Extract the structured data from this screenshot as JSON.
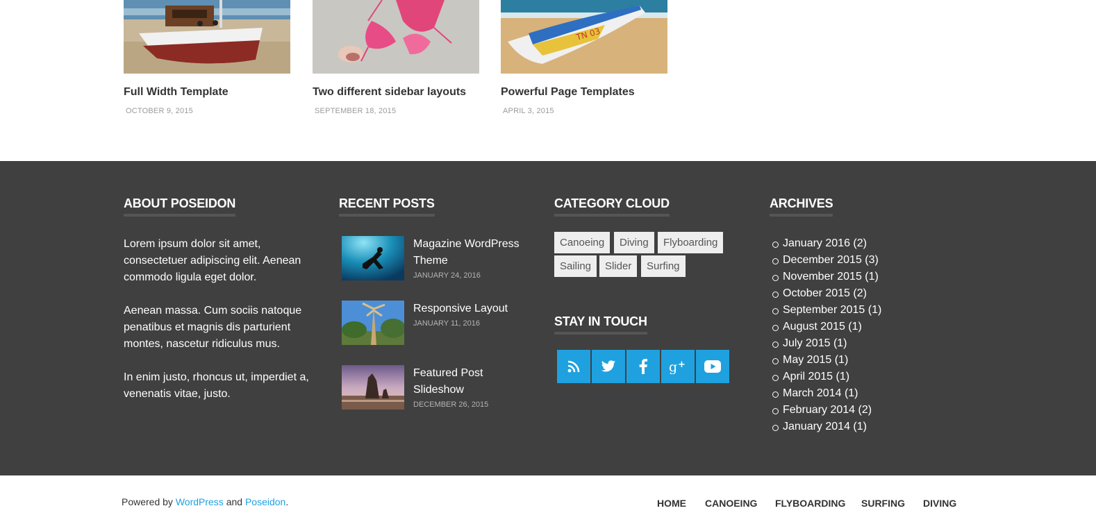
{
  "related_posts": [
    {
      "title": "Full Width Template",
      "date": "October 9, 2015",
      "image": "boat-on-beach-photo"
    },
    {
      "title": "Two different sidebar layouts",
      "date": "September 18, 2015",
      "image": "bikini-on-sand-photo"
    },
    {
      "title": "Powerful Page Templates",
      "date": "April 3, 2015",
      "image": "colorful-fishing-boat-photo"
    }
  ],
  "about": {
    "title": "About Poseidon",
    "paragraphs": [
      "Lorem ipsum dolor sit amet, consectetuer adipiscing elit. Aenean commodo ligula eget dolor.",
      "Aenean massa. Cum sociis natoque penatibus et magnis dis parturient montes, nascetur ridiculus mus.",
      "In enim justo, rhoncus ut, imperdiet a, venenatis vitae, justo."
    ]
  },
  "recent_posts": {
    "title": "Recent Posts",
    "items": [
      {
        "title": "Magazine WordPress Theme",
        "date": "January 24, 2016",
        "image": "diver-underwater-photo"
      },
      {
        "title": "Responsive Layout",
        "date": "January 11, 2016",
        "image": "palm-trees-sky-photo"
      },
      {
        "title": "Featured Post Slideshow",
        "date": "December 26, 2015",
        "image": "sea-rocks-sunset-photo"
      }
    ]
  },
  "category_cloud": {
    "title": "Category Cloud",
    "tags": [
      "Canoeing",
      "Diving",
      "Flyboarding",
      "Sailing",
      "Slider",
      "Surfing"
    ]
  },
  "stay_in_touch": {
    "title": "Stay in Touch",
    "icons": [
      "rss-icon",
      "twitter-icon",
      "facebook-icon",
      "google-plus-icon",
      "youtube-icon"
    ],
    "accent_color": "#1fa1e0"
  },
  "archives": {
    "title": "Archives",
    "items": [
      "January 2016 (2)",
      "December 2015 (3)",
      "November 2015 (1)",
      "October 2015 (2)",
      "September 2015 (1)",
      "August 2015 (1)",
      "July 2015 (1)",
      "May 2015 (1)",
      "April 2015 (1)",
      "March 2014 (1)",
      "February 2014 (2)",
      "January 2014 (1)"
    ]
  },
  "footer": {
    "powered_by": "Powered by ",
    "wordpress_link": "WordPress",
    "and_text": " and ",
    "poseidon_link": "Poseidon",
    "period": ".",
    "nav": [
      "Home",
      "Canoeing",
      "Flyboarding",
      "Surfing",
      "Diving"
    ]
  },
  "colors": {
    "footer_background": "#404040",
    "link": "#1fa1e0"
  }
}
